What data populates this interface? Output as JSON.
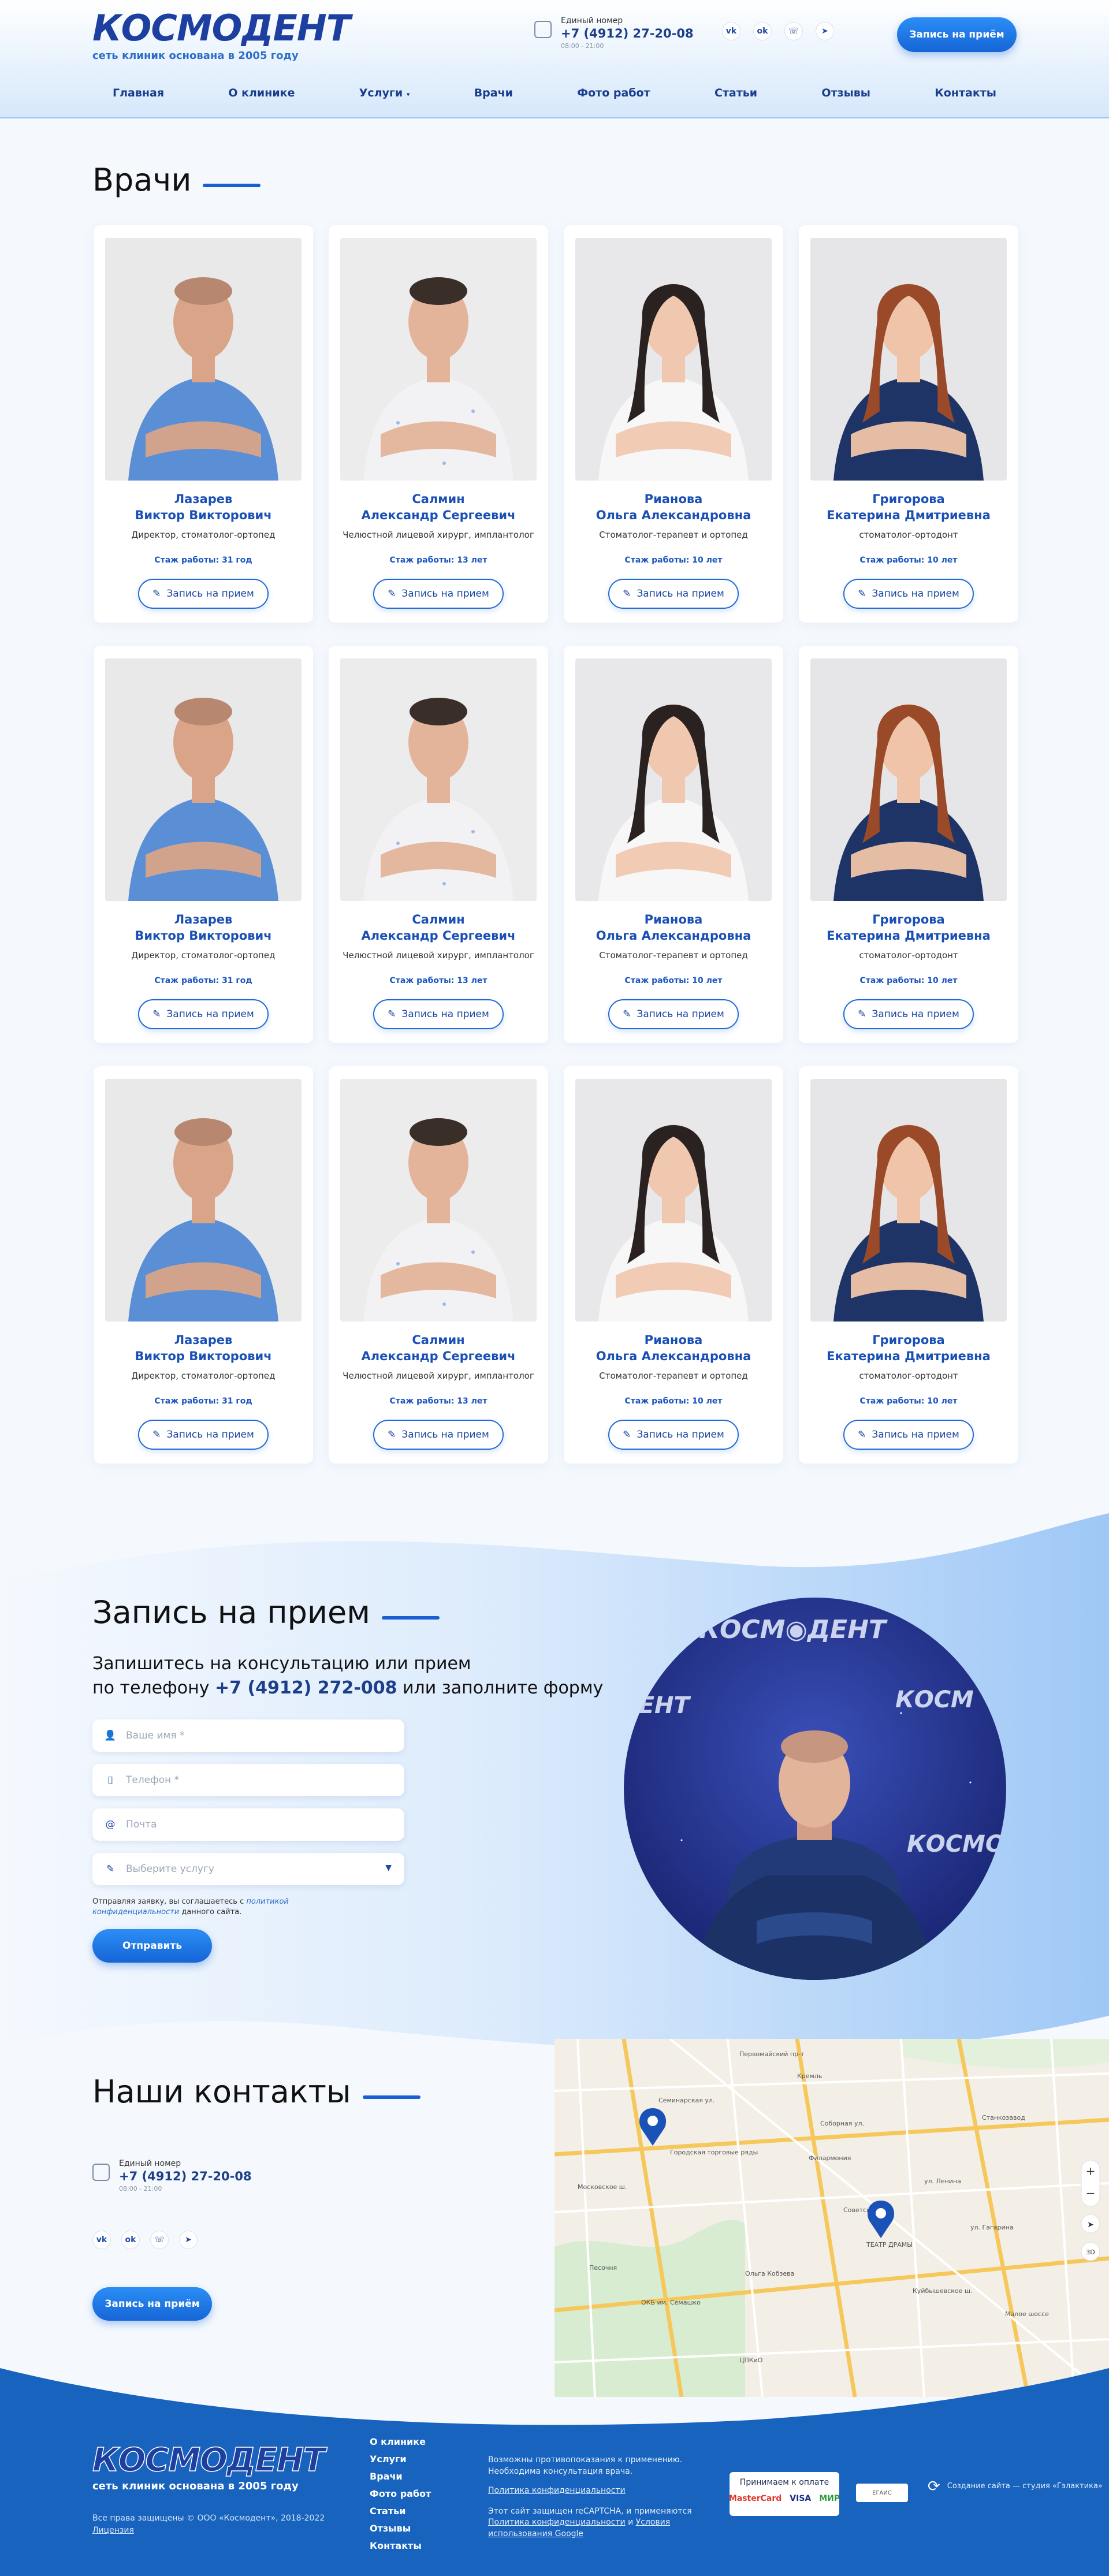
{
  "header": {
    "logo": "КОСМОДЕНТ",
    "tagline": "сеть клиник основана в 2005 году",
    "phone_label": "Единый номер",
    "phone": "+7 (4912) 27-20-08",
    "hours": "08:00 - 21:00",
    "cta": "Запись на приём",
    "socials": [
      "vk",
      "ok",
      "whatsapp",
      "telegram"
    ]
  },
  "nav": [
    "Главная",
    "О клинике",
    "Услуги",
    "Врачи",
    "Фото работ",
    "Статьи",
    "Отзывы",
    "Контакты"
  ],
  "doctors_section": {
    "title": "Врачи"
  },
  "doctors": [
    {
      "surname": "Лазарев",
      "name": "Виктор Викторович",
      "role": "Директор, стоматолог-ортопед",
      "exp": "Стаж работы: 31 год",
      "btn": "Запись на прием"
    },
    {
      "surname": "Салмин",
      "name": "Александр Сергеевич",
      "role": "Челюстной лицевой хирург, имплантолог",
      "exp": "Стаж работы: 13 лет",
      "btn": "Запись на прием"
    },
    {
      "surname": "Рианова",
      "name": "Ольга Александровна",
      "role": "Стоматолог-терапевт и ортопед",
      "exp": "Стаж работы: 10 лет",
      "btn": "Запись на прием"
    },
    {
      "surname": "Григорова",
      "name": "Екатерина Дмитриевна",
      "role": "стоматолог-ортодонт",
      "exp": "Стаж работы: 10 лет",
      "btn": "Запись на прием"
    }
  ],
  "appointment": {
    "title": "Запись на прием",
    "intro_1": "Запишитесь на консультацию или прием",
    "intro_2a": "по телефону ",
    "intro_phone": "+7 (4912) 272-008",
    "intro_2b": " или заполните форму",
    "fields": [
      {
        "placeholder": "Ваше имя *",
        "icon": "user-icon"
      },
      {
        "placeholder": "Телефон *",
        "icon": "phone-icon"
      },
      {
        "placeholder": "Почта",
        "icon": "at-icon"
      },
      {
        "placeholder": "Выберите услугу",
        "icon": "pencil-icon"
      }
    ],
    "consent_a": "Отправляя заявку, вы соглашаетесь с ",
    "consent_link": "политикой конфиденциальности",
    "consent_b": " данного сайта.",
    "submit": "Отправить"
  },
  "contacts": {
    "title": "Наши контакты",
    "phone_label": "Единый номер",
    "phone": "+7 (4912) 27-20-08",
    "hours": "08:00 - 21:00",
    "cta": "Запись на приём",
    "map_labels": [
      "Первомайский пр-т",
      "Семинарская ул.",
      "Соборная ул.",
      "Кремль",
      "Городская торговые ряды",
      "ул. Ленина",
      "Московское ш.",
      "Филармония",
      "ТЕАТР ДРАМЫ",
      "Станкозавод",
      "Куйбышевское ш.",
      "ул. Гагарина",
      "ОКБ им. Семашко",
      "Песочня",
      "ЦПКиО",
      "Ольга Кобзева",
      "Малое шоссе",
      "Советская пл."
    ]
  },
  "footer": {
    "links": [
      "О клинике",
      "Услуги",
      "Врачи",
      "Фото работ",
      "Статьи",
      "Отзывы",
      "Контакты"
    ],
    "note1": "Возможны противопоказания к применению. Необходима консультация врача.",
    "privacy": "Политика конфиденциальности",
    "note2a": "Этот сайт защищен reCAPTCHA, и применяются ",
    "note2_link1": "Политика конфиденциальности",
    "note2b": " и ",
    "note2_link2": "Условия использования Google",
    "pay_title": "Принимаем к оплате",
    "pay": [
      "MasterCard",
      "VISA",
      "МИР"
    ],
    "badge": "ЕГАИС",
    "studio": "Создание сайта — студия «Гэлактика»",
    "copyright": "Все права защищены © ООО «Космодент», 2018-2022",
    "license": "Лицензия"
  }
}
